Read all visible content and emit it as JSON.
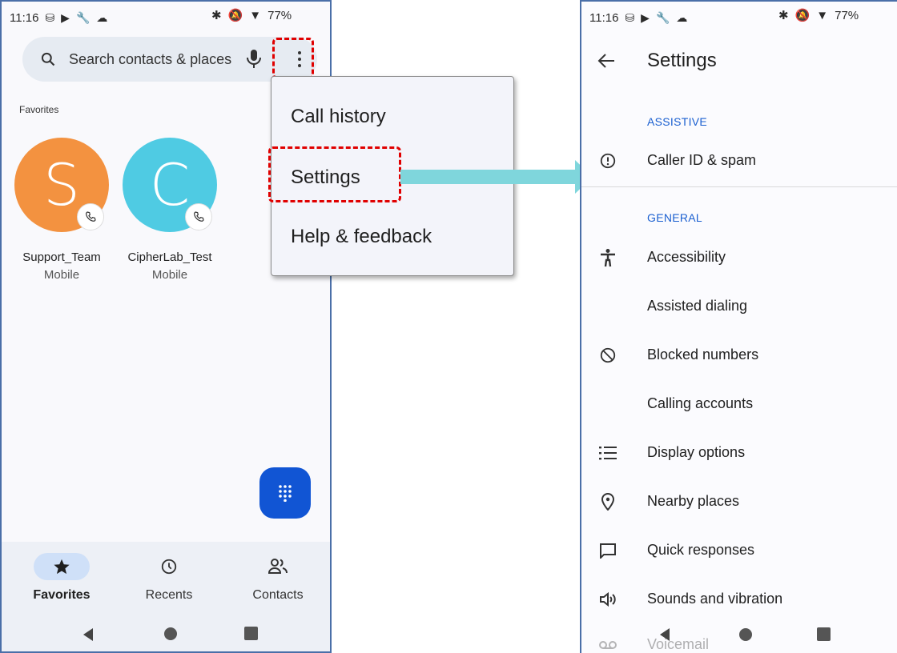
{
  "left_screen": {
    "status": {
      "time": "11:16",
      "battery": "77%"
    },
    "search": {
      "placeholder": "Search contacts & places"
    },
    "favorites_heading": "Favorites",
    "contacts": [
      {
        "initial": "S",
        "name": "Support_Team",
        "type": "Mobile",
        "color": "#f39240"
      },
      {
        "initial": "C",
        "name": "CipherLab_Test",
        "type": "Mobile",
        "color": "#4fcbe3"
      }
    ],
    "bottom_nav": [
      {
        "label": "Favorites",
        "icon": "star-icon",
        "active": true
      },
      {
        "label": "Recents",
        "icon": "clock-icon",
        "active": false
      },
      {
        "label": "Contacts",
        "icon": "people-icon",
        "active": false
      }
    ]
  },
  "menu": {
    "items": [
      "Call history",
      "Settings",
      "Help & feedback"
    ]
  },
  "right_screen": {
    "status": {
      "time": "11:16",
      "battery": "77%"
    },
    "title": "Settings",
    "sections": [
      {
        "header": "ASSISTIVE",
        "items": [
          {
            "label": "Caller ID & spam",
            "icon": "alert-circle-icon"
          }
        ]
      },
      {
        "header": "GENERAL",
        "items": [
          {
            "label": "Accessibility",
            "icon": "accessibility-icon"
          },
          {
            "label": "Assisted dialing",
            "icon": ""
          },
          {
            "label": "Blocked numbers",
            "icon": "block-icon"
          },
          {
            "label": "Calling accounts",
            "icon": ""
          },
          {
            "label": "Display options",
            "icon": "list-icon"
          },
          {
            "label": "Nearby places",
            "icon": "location-pin-icon"
          },
          {
            "label": "Quick responses",
            "icon": "message-icon"
          },
          {
            "label": "Sounds and vibration",
            "icon": "speaker-icon"
          },
          {
            "label": "Voicemail",
            "icon": "voicemail-icon"
          }
        ]
      }
    ]
  },
  "colors": {
    "accent": "#1155d4",
    "highlight": "#e00000",
    "arrow": "#7fd6dc",
    "section_header": "#1a5fd0"
  }
}
